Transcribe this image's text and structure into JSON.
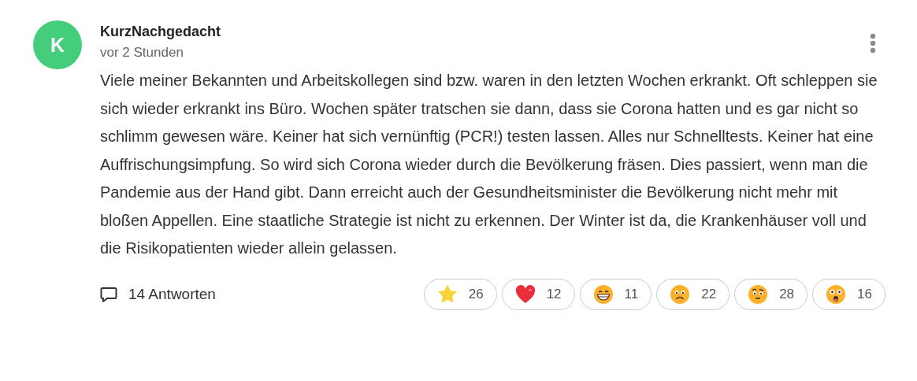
{
  "comment": {
    "avatar_letter": "K",
    "author": "KurzNachgedacht",
    "time": "vor 2 Stunden",
    "text": "Viele meiner Bekannten und Arbeitskollegen sind bzw. waren in den letzten Wochen erkrankt. Oft schleppen sie sich wieder erkrankt ins Büro. Wochen später tratschen sie dann, dass sie Corona hatten und es gar nicht so schlimm gewesen wäre. Keiner hat sich vernünftig (PCR!) testen lassen. Alles nur Schnelltests. Keiner hat eine Auffrischungsimpfung. So wird sich Corona wieder durch die Bevölkerung fräsen. Dies passiert, wenn man die Pandemie aus der Hand gibt. Dann erreicht auch der Gesundheitsminister die Bevölkerung nicht mehr mit bloßen Appellen. Eine staatliche Strategie ist nicht zu erkennen. Der Winter ist da, die Krankenhäuser voll und die Risikopatienten wieder allein gelassen.",
    "replies": "14 Antworten",
    "reactions": [
      {
        "kind": "star",
        "count": "26"
      },
      {
        "kind": "heart",
        "count": "12"
      },
      {
        "kind": "grin",
        "count": "11"
      },
      {
        "kind": "frown",
        "count": "22"
      },
      {
        "kind": "skeptical",
        "count": "28"
      },
      {
        "kind": "astonished",
        "count": "16"
      }
    ]
  }
}
